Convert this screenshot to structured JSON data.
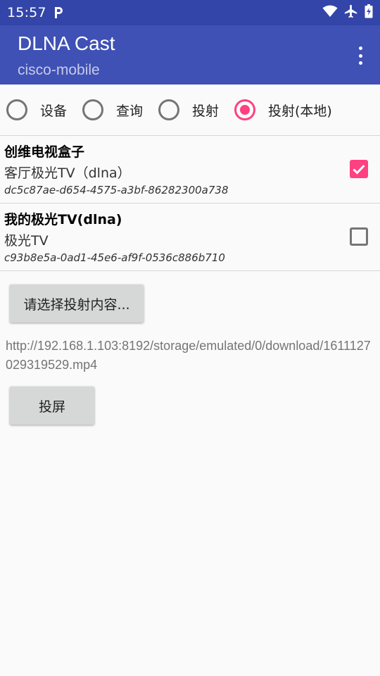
{
  "status_bar": {
    "time": "15:57",
    "icons": [
      "parking-icon",
      "wifi-icon",
      "airplane-icon",
      "battery-icon"
    ]
  },
  "app_bar": {
    "title": "DLNA Cast",
    "subtitle": "cisco-mobile",
    "menu_icon": "more-vert-icon"
  },
  "radio_group": {
    "options": [
      {
        "label": "设备",
        "checked": false
      },
      {
        "label": "查询",
        "checked": false
      },
      {
        "label": "投射",
        "checked": false
      },
      {
        "label": "投射(本地)",
        "checked": true
      }
    ]
  },
  "devices": [
    {
      "name": "创维电视盒子",
      "model": "客厅极光TV（dlna）",
      "udn": "dc5c87ae-d654-4575-a3bf-86282300a738",
      "checked": true
    },
    {
      "name": "我的极光TV(dlna)",
      "model": "极光TV",
      "udn": "c93b8e5a-0ad1-45e6-af9f-0536c886b710",
      "checked": false
    }
  ],
  "select_button": {
    "label": "请选择投射内容..."
  },
  "content_url": "http://192.168.1.103:8192/storage/emulated/0/download/1611127029319529.mp4",
  "cast_button": {
    "label": "投屏"
  },
  "colors": {
    "status_bar": "#3345a8",
    "app_bar": "#3f51b5",
    "accent": "#ff4081"
  }
}
